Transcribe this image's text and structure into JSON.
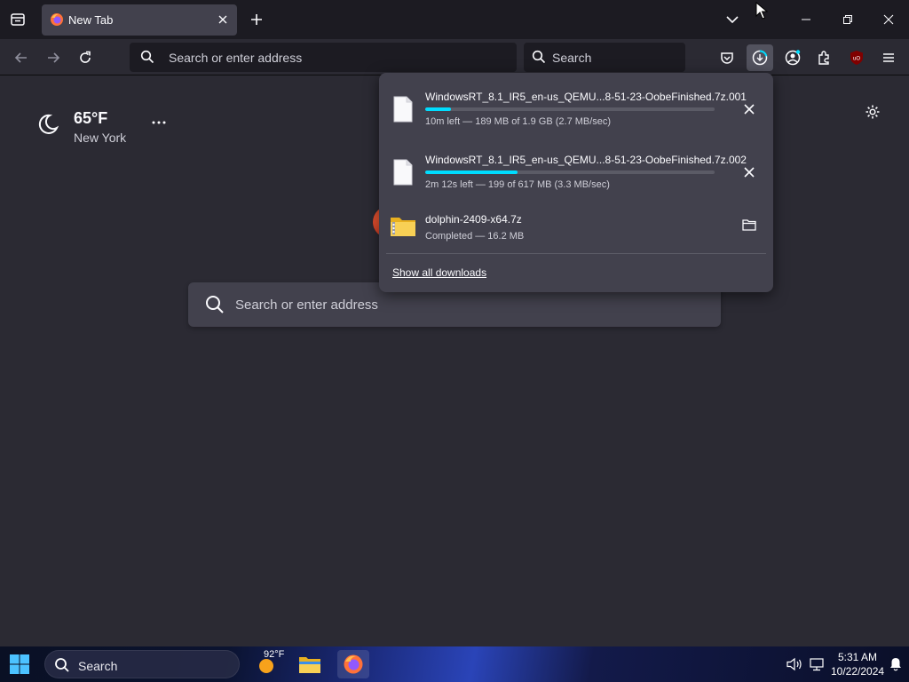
{
  "tab": {
    "title": "New Tab"
  },
  "urlbar": {
    "placeholder": "Search or enter address"
  },
  "searchbar": {
    "placeholder": "Search"
  },
  "weather": {
    "temperature": "65°F",
    "city": "New York"
  },
  "newtab_search": {
    "placeholder": "Search or enter address"
  },
  "downloads": {
    "items": [
      {
        "name": "WindowsRT_8.1_IR5_en-us_QEMU...8-51-23-OobeFinished.7z.001",
        "status": "10m left — 189 MB of 1.9 GB (2.7 MB/sec)",
        "progress": 0.09,
        "icon": "generic-file-icon",
        "action": "cancel"
      },
      {
        "name": "WindowsRT_8.1_IR5_en-us_QEMU...8-51-23-OobeFinished.7z.002",
        "status": "2m 12s left — 199 of 617 MB (3.3 MB/sec)",
        "progress": 0.32,
        "icon": "generic-file-icon",
        "action": "cancel"
      },
      {
        "name": "dolphin-2409-x64.7z",
        "status": "Completed — 16.2 MB",
        "icon": "zip-folder-icon",
        "action": "open-folder"
      }
    ],
    "show_all_label": "Show all downloads"
  },
  "taskbar": {
    "search_label": "Search",
    "weather_temp": "92°F",
    "time": "5:31 AM",
    "date": "10/22/2024"
  },
  "colors": {
    "accent": "#00ddff",
    "toolbar": "#2b2a33",
    "tabstrip": "#1c1b22",
    "panel": "#42414d"
  }
}
